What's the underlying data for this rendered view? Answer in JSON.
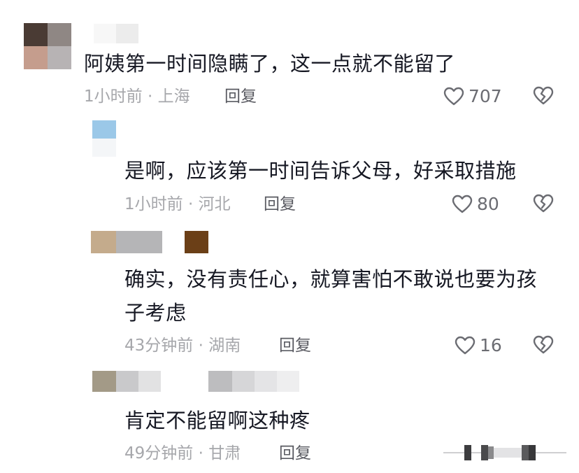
{
  "comments": [
    {
      "text": "阿姨第一时间隐瞒了，这一点就不能留了",
      "meta": "1小时前 · 上海",
      "reply_label": "回复",
      "likes": "707"
    },
    {
      "text": "是啊，应该第一时间告诉父母，好采取措施",
      "meta": "1小时前 · 河北",
      "reply_label": "回复",
      "likes": "80"
    },
    {
      "text_line1": "确实，没有责任心，就算害怕不敢说也要为孩",
      "text_line2": "子考虑",
      "meta": "43分钟前 · 湖南",
      "reply_label": "回复",
      "likes": "16"
    },
    {
      "text": "肯定不能留啊这种疼",
      "meta": "49分钟前 · 甘肃",
      "reply_label": "回复"
    }
  ],
  "icons": {
    "like": "heart-outline-icon",
    "dislike": "broken-heart-icon"
  },
  "colors": {
    "text": "#161823",
    "meta": "#a6a7ab",
    "reply": "#5a5b62",
    "icon": "#6b6c72"
  }
}
